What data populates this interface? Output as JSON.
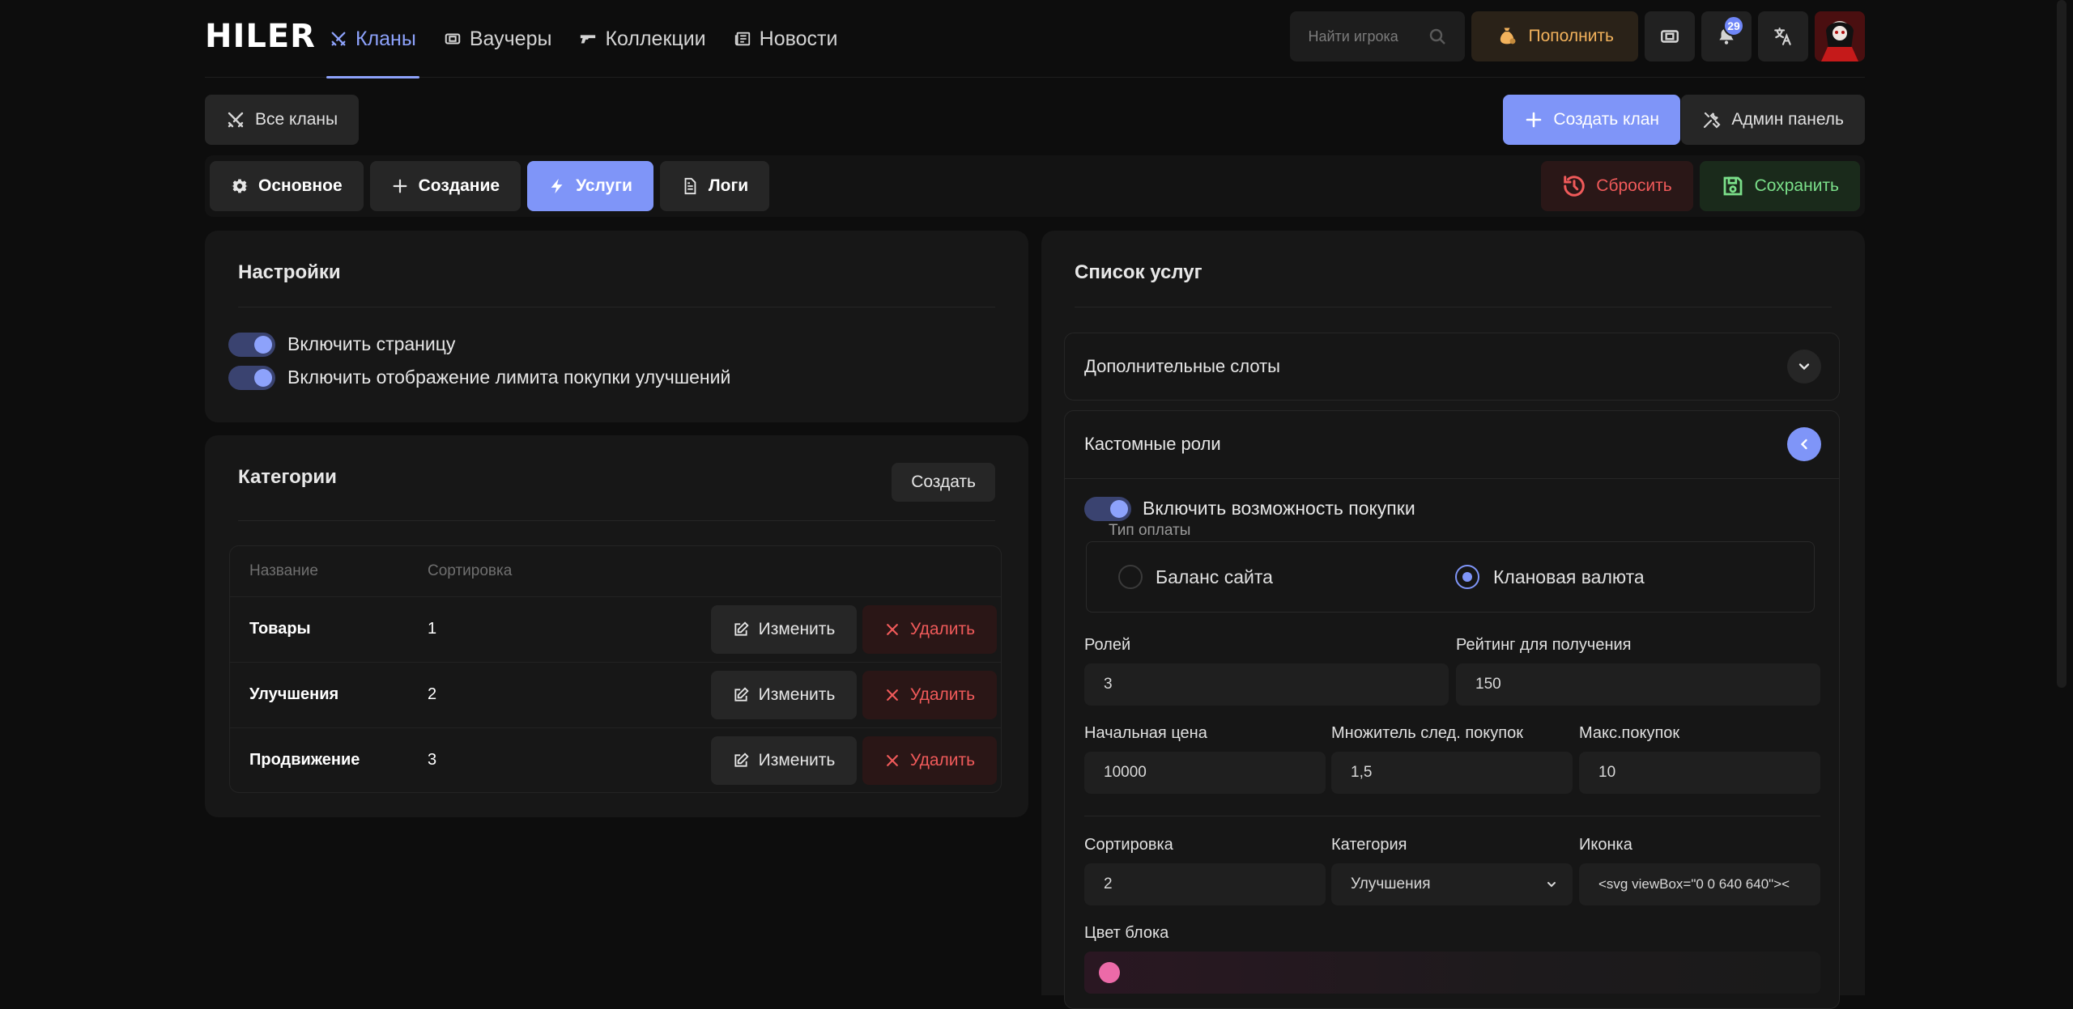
{
  "brand": {
    "logo": "HILER",
    "accent": "#7f95f8"
  },
  "nav": [
    {
      "label": "Кланы",
      "icon": "swords-icon",
      "active": true
    },
    {
      "label": "Ваучеры",
      "icon": "ticket-icon"
    },
    {
      "label": "Коллекции",
      "icon": "gun-icon"
    },
    {
      "label": "Новости",
      "icon": "newspaper-icon"
    }
  ],
  "header": {
    "search_placeholder": "Найти игрока",
    "topup_label": "Пополнить",
    "notifications_count": "29"
  },
  "actions": {
    "all_clans": "Все кланы",
    "create_clan": "Создать клан",
    "admin_panel": "Админ панель"
  },
  "tabs": {
    "items": [
      {
        "label": "Основное",
        "icon": "gear-icon"
      },
      {
        "label": "Создание",
        "icon": "plus-icon"
      },
      {
        "label": "Услуги",
        "icon": "bolt-icon",
        "active": true
      },
      {
        "label": "Логи",
        "icon": "document-icon"
      }
    ],
    "reset": "Сбросить",
    "save": "Сохранить"
  },
  "settings": {
    "title": "Настройки",
    "toggles": [
      {
        "label": "Включить страницу",
        "on": true
      },
      {
        "label": "Включить отображение лимита покупки улучшений",
        "on": true
      }
    ]
  },
  "categories": {
    "title": "Категории",
    "create": "Создать",
    "columns": [
      "Название",
      "Сортировка"
    ],
    "edit_label": "Изменить",
    "delete_label": "Удалить",
    "rows": [
      {
        "name": "Товары",
        "sort": "1"
      },
      {
        "name": "Улучшения",
        "sort": "2"
      },
      {
        "name": "Продвижение",
        "sort": "3"
      }
    ]
  },
  "services": {
    "title": "Список услуг",
    "accordion_1": "Дополнительные слоты",
    "accordion_2": "Кастомные роли",
    "enable_purchase": "Включить возможность покупки",
    "payment_type": "Тип оплаты",
    "payment_options": [
      {
        "label": "Баланс сайта",
        "selected": false
      },
      {
        "label": "Клановая валюта",
        "selected": true
      }
    ],
    "fields": {
      "roles_label": "Ролей",
      "roles_value": "3",
      "rating_label": "Рейтинг для получения",
      "rating_value": "150",
      "start_price_label": "Начальная цена",
      "start_price_value": "10000",
      "multiplier_label": "Множитель след. покупок",
      "multiplier_value": "1,5",
      "max_label": "Макс.покупок",
      "max_value": "10",
      "sort_label": "Сортировка",
      "sort_value": "2",
      "category_label": "Категория",
      "category_value": "Улучшения",
      "icon_label": "Иконка",
      "icon_value": "<svg viewBox=\"0 0 640 640\"><",
      "color_label": "Цвет блока",
      "color_value": "#ec6aa8"
    }
  }
}
